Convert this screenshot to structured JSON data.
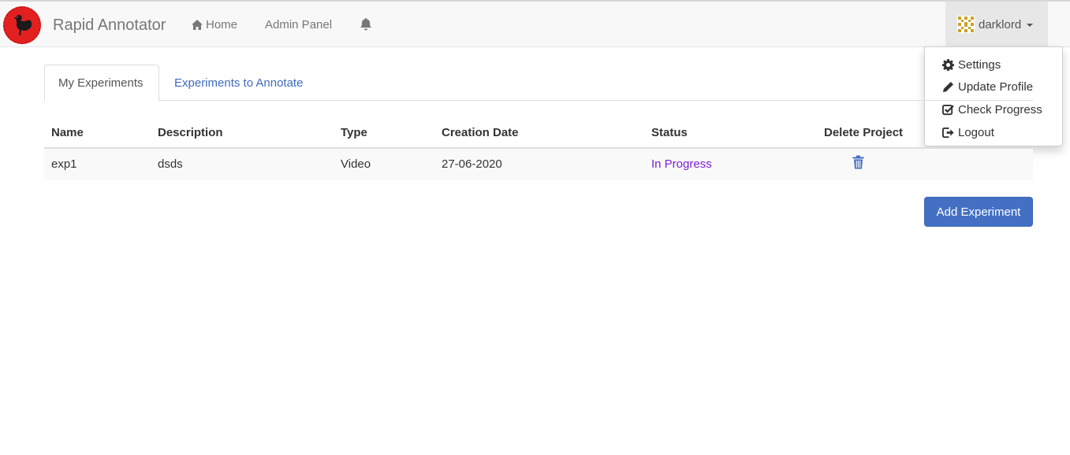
{
  "navbar": {
    "brand": "Rapid Annotator",
    "home_label": "Home",
    "admin_label": "Admin Panel",
    "username": "darklord",
    "icons": {
      "logo": "rooster-logo",
      "home": "home-icon",
      "bell": "bell-icon",
      "avatar": "identicon-avatar"
    },
    "colors": {
      "logo_red": "#e32020",
      "avatar_gold": "#c9a227"
    }
  },
  "user_menu": {
    "items": [
      {
        "label": "Settings",
        "icon": "gear-icon"
      },
      {
        "label": "Update Profile",
        "icon": "pencil-icon"
      },
      {
        "label": "Check Progress",
        "icon": "check-square-icon"
      },
      {
        "label": "Logout",
        "icon": "logout-icon"
      }
    ]
  },
  "tabs": [
    {
      "label": "My Experiments",
      "active": true
    },
    {
      "label": "Experiments to Annotate",
      "active": false
    }
  ],
  "table": {
    "headers": [
      "Name",
      "Description",
      "Type",
      "Creation Date",
      "Status",
      "Delete Project"
    ],
    "rows": [
      {
        "name": "exp1",
        "description": "dsds",
        "type": "Video",
        "creation_date": "27-06-2020",
        "status": "In Progress"
      }
    ]
  },
  "actions": {
    "add_experiment_label": "Add Experiment"
  },
  "colors": {
    "link": "#3f6bbf",
    "status": "#7a1fd6",
    "primary_button": "#4470c4"
  }
}
